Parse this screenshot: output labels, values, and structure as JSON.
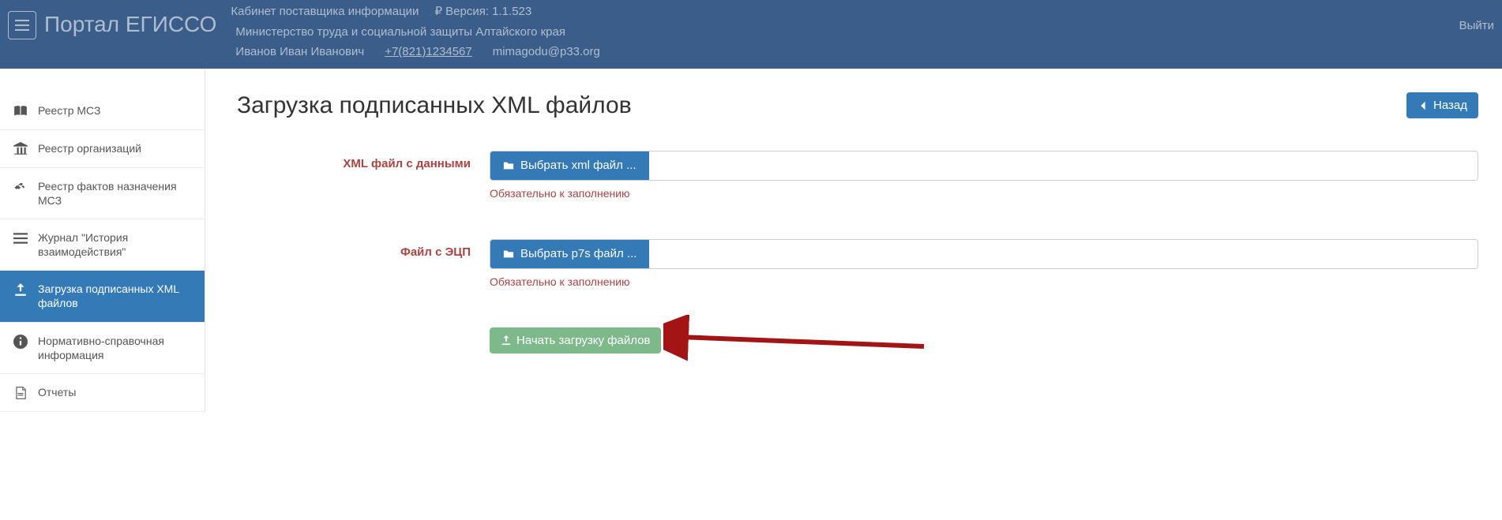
{
  "header": {
    "brand": "Портал ЕГИССО",
    "cabinet": "Кабинет поставщика информации",
    "version": "₽ Версия: 1.1.523",
    "org": "Министерство труда и социальной защиты Алтайского края",
    "user": "Иванов Иван Иванович",
    "phone": "+7(821)1234567",
    "email": "mimagodu@p33.org",
    "logout": "Выйти"
  },
  "sidebar": {
    "items": [
      {
        "label": "Реестр МСЗ"
      },
      {
        "label": "Реестр организаций"
      },
      {
        "label": "Реестр фактов назначения МСЗ"
      },
      {
        "label": "Журнал \"История взаимодействия\""
      },
      {
        "label": "Загрузка подписанных XML файлов"
      },
      {
        "label": "Нормативно-справочная информация"
      },
      {
        "label": "Отчеты"
      }
    ]
  },
  "page": {
    "title": "Загрузка подписанных XML файлов",
    "back_label": "Назад"
  },
  "form": {
    "xml": {
      "label": "XML файл с данными",
      "button": "Выбрать xml файл ...",
      "help": "Обязательно к заполнению"
    },
    "sig": {
      "label": "Файл с ЭЦП",
      "button": "Выбрать p7s файл ...",
      "help": "Обязательно к заполнению"
    },
    "submit": "Начать загрузку файлов"
  }
}
